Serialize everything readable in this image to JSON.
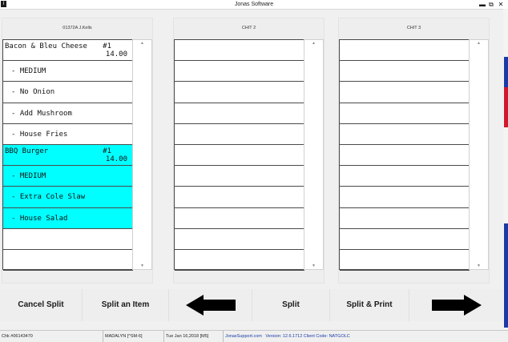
{
  "window": {
    "title": "Jonas Software",
    "app_icon": "I",
    "minimize": "▬",
    "restore": "⧉",
    "close": "✕"
  },
  "accent_colors": [
    "#1a3aa8",
    "#d0182c",
    "#1a3aa8"
  ],
  "highlight_color": "#00ffff",
  "chits": [
    {
      "header": "01372A J.Kells",
      "items": [
        {
          "name": "Bacon & Bleu Cheese",
          "num": "#1",
          "price": "14.00",
          "mod": false,
          "hl": false
        },
        {
          "name": "- MEDIUM",
          "mod": true,
          "hl": false
        },
        {
          "name": "- No Onion",
          "mod": true,
          "hl": false
        },
        {
          "name": "- Add Mushroom",
          "mod": true,
          "hl": false
        },
        {
          "name": "- House Fries",
          "mod": true,
          "hl": false
        },
        {
          "name": "BBQ Burger",
          "num": "#1",
          "price": "14.00",
          "mod": false,
          "hl": true
        },
        {
          "name": "- MEDIUM",
          "mod": true,
          "hl": true
        },
        {
          "name": "- Extra Cole Slaw",
          "mod": true,
          "hl": true
        },
        {
          "name": "- House Salad",
          "mod": true,
          "hl": true
        },
        {
          "name": "",
          "mod": false,
          "hl": false
        },
        {
          "name": "",
          "mod": false,
          "hl": false
        }
      ]
    },
    {
      "header": "CHIT 2",
      "items": []
    },
    {
      "header": "CHIT 3",
      "items": []
    }
  ],
  "scroll_up": "▲",
  "scroll_down": "▼",
  "toolbar": {
    "cancel_split": "Cancel Split",
    "split_item": "Split an Item",
    "left_arrow": "left-arrow-icon",
    "split": "Split",
    "split_print": "Split & Print",
    "right_arrow": "right-arrow-icon"
  },
  "status": {
    "check": "Chk #06143470",
    "user": "MADALYN [^SM-6]",
    "date": "Tue Jan 16,2018 [M5]",
    "support_link": "JonasSupport.com",
    "version": "Version: 12.6.1712 Client Code: NATGOLC"
  }
}
